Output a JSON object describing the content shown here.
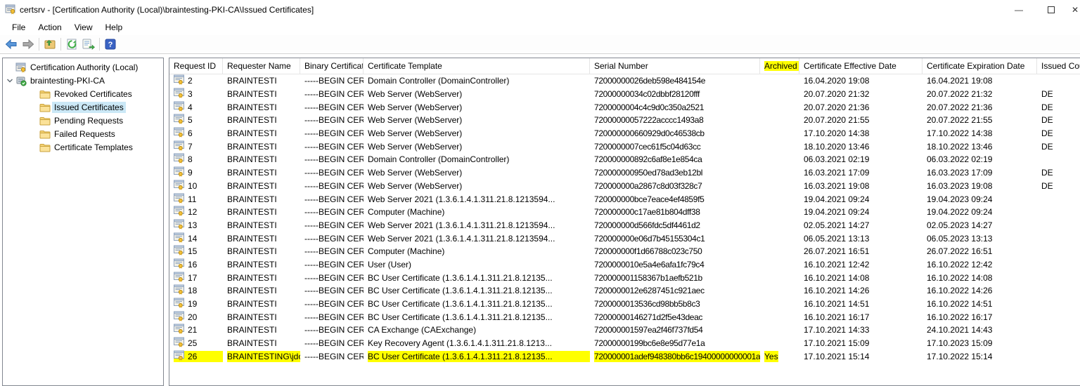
{
  "window": {
    "title": "certsrv - [Certification Authority (Local)\\braintesting-PKI-CA\\Issued Certificates]",
    "minimize_glyph": "—",
    "close_glyph": "✕"
  },
  "menu": {
    "items": [
      "File",
      "Action",
      "View",
      "Help"
    ]
  },
  "toolbar": {
    "buttons": [
      "back",
      "forward",
      "up-one-level",
      "refresh",
      "export-list",
      "help"
    ]
  },
  "tree": {
    "root": "Certification Authority (Local)",
    "ca": "braintesting-PKI-CA",
    "children": [
      "Revoked Certificates",
      "Issued Certificates",
      "Pending Requests",
      "Failed Requests",
      "Certificate Templates"
    ],
    "selected": "Issued Certificates"
  },
  "table": {
    "columns": [
      "Request ID",
      "Requester Name",
      "Binary Certificate",
      "Certificate Template",
      "Serial Number",
      "Archived Key",
      "Certificate Effective Date",
      "Certificate Expiration Date",
      "Issued Cou"
    ],
    "highlighted_column": "Archived Key",
    "rows": [
      {
        "id": "2",
        "requester": "BRAINTESTI",
        "binary": "-----BEGIN CERTI...",
        "template": "Domain Controller (DomainController)",
        "serial": "72000000026deb598e484154e",
        "archived": "",
        "effective": "16.04.2020 19:08",
        "expiration": "16.04.2021 19:08",
        "country": ""
      },
      {
        "id": "3",
        "requester": "BRAINTESTI",
        "binary": "-----BEGIN CERTI...",
        "template": "Web Server (WebServer)",
        "serial": "72000000034c02dbbf28120fff",
        "archived": "",
        "effective": "20.07.2020 21:32",
        "expiration": "20.07.2022 21:32",
        "country": "DE"
      },
      {
        "id": "4",
        "requester": "BRAINTESTI",
        "binary": "-----BEGIN CERTI...",
        "template": "Web Server (WebServer)",
        "serial": "7200000004c4c9d0c350a2521",
        "archived": "",
        "effective": "20.07.2020 21:36",
        "expiration": "20.07.2022 21:36",
        "country": "DE"
      },
      {
        "id": "5",
        "requester": "BRAINTESTI",
        "binary": "-----BEGIN CERTI...",
        "template": "Web Server (WebServer)",
        "serial": "72000000057222acccc1493a8",
        "archived": "",
        "effective": "20.07.2020 21:55",
        "expiration": "20.07.2022 21:55",
        "country": "DE"
      },
      {
        "id": "6",
        "requester": "BRAINTESTI",
        "binary": "-----BEGIN CERTI...",
        "template": "Web Server (WebServer)",
        "serial": "720000000660929d0c46538cb",
        "archived": "",
        "effective": "17.10.2020 14:38",
        "expiration": "17.10.2022 14:38",
        "country": "DE"
      },
      {
        "id": "7",
        "requester": "BRAINTESTI",
        "binary": "-----BEGIN CERTI...",
        "template": "Web Server (WebServer)",
        "serial": "7200000007cec61f5c04d63cc",
        "archived": "",
        "effective": "18.10.2020 13:46",
        "expiration": "18.10.2022 13:46",
        "country": "DE"
      },
      {
        "id": "8",
        "requester": "BRAINTESTI",
        "binary": "-----BEGIN CERTI...",
        "template": "Domain Controller (DomainController)",
        "serial": "720000000892c6af8e1e854ca",
        "archived": "",
        "effective": "06.03.2021 02:19",
        "expiration": "06.03.2022 02:19",
        "country": ""
      },
      {
        "id": "9",
        "requester": "BRAINTESTI",
        "binary": "-----BEGIN CERTI...",
        "template": "Web Server (WebServer)",
        "serial": "720000000950ed78ad3eb12bl",
        "archived": "",
        "effective": "16.03.2021 17:09",
        "expiration": "16.03.2023 17:09",
        "country": "DE"
      },
      {
        "id": "10",
        "requester": "BRAINTESTI",
        "binary": "-----BEGIN CERTI...",
        "template": "Web Server (WebServer)",
        "serial": "720000000a2867c8d03f328c7",
        "archived": "",
        "effective": "16.03.2021 19:08",
        "expiration": "16.03.2023 19:08",
        "country": "DE"
      },
      {
        "id": "11",
        "requester": "BRAINTESTI",
        "binary": "-----BEGIN CERTI...",
        "template": "Web Server 2021 (1.3.6.1.4.1.311.21.8.1213594...",
        "serial": "720000000bce7eace4ef4859f5",
        "archived": "",
        "effective": "19.04.2021 09:24",
        "expiration": "19.04.2023 09:24",
        "country": ""
      },
      {
        "id": "12",
        "requester": "BRAINTESTI",
        "binary": "-----BEGIN CERTI...",
        "template": "Computer (Machine)",
        "serial": "720000000c17ae81b804dff38",
        "archived": "",
        "effective": "19.04.2021 09:24",
        "expiration": "19.04.2022 09:24",
        "country": ""
      },
      {
        "id": "13",
        "requester": "BRAINTESTI",
        "binary": "-----BEGIN CERTI...",
        "template": "Web Server 2021 (1.3.6.1.4.1.311.21.8.1213594...",
        "serial": "720000000d566fdc5df4461d2",
        "archived": "",
        "effective": "02.05.2021 14:27",
        "expiration": "02.05.2023 14:27",
        "country": ""
      },
      {
        "id": "14",
        "requester": "BRAINTESTI",
        "binary": "-----BEGIN CERTI...",
        "template": "Web Server 2021 (1.3.6.1.4.1.311.21.8.1213594...",
        "serial": "720000000e06d7b45155304c1",
        "archived": "",
        "effective": "06.05.2021 13:13",
        "expiration": "06.05.2023 13:13",
        "country": ""
      },
      {
        "id": "15",
        "requester": "BRAINTESTI",
        "binary": "-----BEGIN CERTI...",
        "template": "Computer (Machine)",
        "serial": "720000000f1d66788c023c750",
        "archived": "",
        "effective": "26.07.2021 16:51",
        "expiration": "26.07.2022 16:51",
        "country": ""
      },
      {
        "id": "16",
        "requester": "BRAINTESTI",
        "binary": "-----BEGIN CERTI...",
        "template": "User (User)",
        "serial": "7200000010e5a4e6afa1fc79c4",
        "archived": "",
        "effective": "16.10.2021 12:42",
        "expiration": "16.10.2022 12:42",
        "country": ""
      },
      {
        "id": "17",
        "requester": "BRAINTESTI",
        "binary": "-----BEGIN CERTI...",
        "template": "BC User Certificate (1.3.6.1.4.1.311.21.8.12135...",
        "serial": "720000001158367b1aefb521b",
        "archived": "",
        "effective": "16.10.2021 14:08",
        "expiration": "16.10.2022 14:08",
        "country": ""
      },
      {
        "id": "18",
        "requester": "BRAINTESTI",
        "binary": "-----BEGIN CERTI...",
        "template": "BC User Certificate (1.3.6.1.4.1.311.21.8.12135...",
        "serial": "7200000012e6287451c921aec",
        "archived": "",
        "effective": "16.10.2021 14:26",
        "expiration": "16.10.2022 14:26",
        "country": ""
      },
      {
        "id": "19",
        "requester": "BRAINTESTI",
        "binary": "-----BEGIN CERTI...",
        "template": "BC User Certificate (1.3.6.1.4.1.311.21.8.12135...",
        "serial": "7200000013536cd98bb5b8c3",
        "archived": "",
        "effective": "16.10.2021 14:51",
        "expiration": "16.10.2022 14:51",
        "country": ""
      },
      {
        "id": "20",
        "requester": "BRAINTESTI",
        "binary": "-----BEGIN CERTI...",
        "template": "BC User Certificate (1.3.6.1.4.1.311.21.8.12135...",
        "serial": "72000000146271d2f5e43deac",
        "archived": "",
        "effective": "16.10.2021 16:17",
        "expiration": "16.10.2022 16:17",
        "country": ""
      },
      {
        "id": "21",
        "requester": "BRAINTESTI",
        "binary": "-----BEGIN CERTI...",
        "template": "CA Exchange (CAExchange)",
        "serial": "720000001597ea2f46f737fd54",
        "archived": "",
        "effective": "17.10.2021 14:33",
        "expiration": "24.10.2021 14:43",
        "country": ""
      },
      {
        "id": "25",
        "requester": "BRAINTESTI",
        "binary": "-----BEGIN CERTI...",
        "template": "Key Recovery Agent (1.3.6.1.4.1.311.21.8.1213...",
        "serial": "72000000199bc6e8e95d77e1a",
        "archived": "",
        "effective": "17.10.2021 15:09",
        "expiration": "17.10.2023 15:09",
        "country": ""
      },
      {
        "id": "26",
        "requester": "BRAINTESTING\\jdoe",
        "binary": "-----BEGIN CERTI...",
        "template": "BC User Certificate (1.3.6.1.4.1.311.21.8.12135...",
        "serial": "720000001adef948380bb6c19400000000001a",
        "archived": "Yes",
        "effective": "17.10.2021 15:14",
        "expiration": "17.10.2022 15:14",
        "country": "",
        "highlighted": true
      }
    ]
  },
  "colors": {
    "highlight": "#ffff00",
    "tree_selection": "#cbe8f6"
  }
}
